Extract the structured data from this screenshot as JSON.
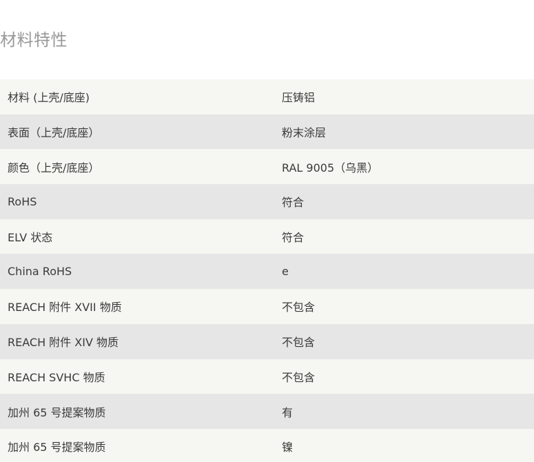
{
  "section": {
    "title": "材料特性"
  },
  "properties": [
    {
      "label": "材料 (上壳/底座)",
      "value": "压铸铝"
    },
    {
      "label": "表面（上壳/底座）",
      "value": "粉末涂层"
    },
    {
      "label": "颜色（上壳/底座）",
      "value": "RAL 9005（乌黑）"
    },
    {
      "label": "RoHS",
      "value": "符合"
    },
    {
      "label": "ELV 状态",
      "value": "符合"
    },
    {
      "label": "China RoHS",
      "value": "e"
    },
    {
      "label": "REACH 附件 XVII 物质",
      "value": "不包含"
    },
    {
      "label": "REACH 附件 XIV 物质",
      "value": "不包含"
    },
    {
      "label": "REACH SVHC 物质",
      "value": "不包含"
    },
    {
      "label": "加州 65 号提案物质",
      "value": "有"
    },
    {
      "label": "加州 65 号提案物质",
      "value": "镍"
    }
  ]
}
